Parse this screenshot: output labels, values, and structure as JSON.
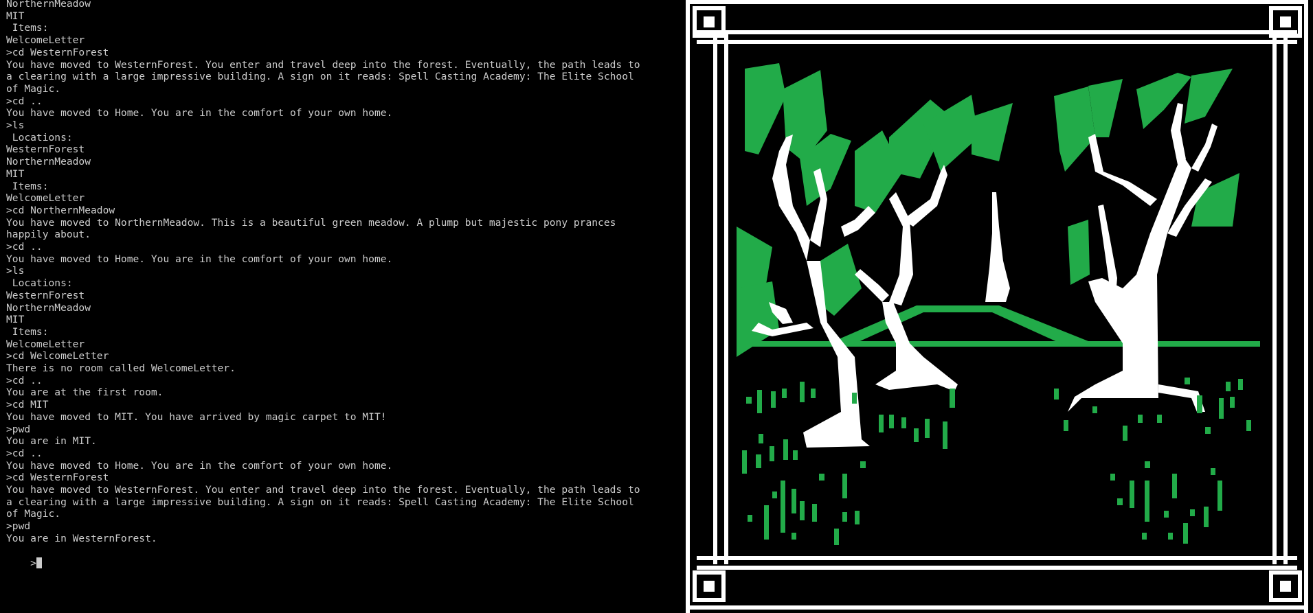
{
  "colors": {
    "background": "#000000",
    "text": "#cccccc",
    "tree_green": "#22ab49",
    "frame_white": "#ffffff"
  },
  "terminal": {
    "lines": [
      "NorthernMeadow",
      "MIT",
      " Items:",
      "WelcomeLetter",
      ">cd WesternForest",
      "You have moved to WesternForest. You enter and travel deep into the forest. Eventually, the path leads to",
      "a clearing with a large impressive building. A sign on it reads: Spell Casting Academy: The Elite School",
      "of Magic.",
      ">cd ..",
      "You have moved to Home. You are in the comfort of your own home.",
      ">ls",
      " Locations:",
      "WesternForest",
      "NorthernMeadow",
      "MIT",
      " Items:",
      "WelcomeLetter",
      ">cd NorthernMeadow",
      "You have moved to NorthernMeadow. This is a beautiful green meadow. A plump but majestic pony prances",
      "happily about.",
      ">cd ..",
      "You have moved to Home. You are in the comfort of your own home.",
      ">ls",
      " Locations:",
      "WesternForest",
      "NorthernMeadow",
      "MIT",
      " Items:",
      "WelcomeLetter",
      ">cd WelcomeLetter",
      "There is no room called WelcomeLetter.",
      ">cd ..",
      "You are at the first room.",
      ">cd MIT",
      "You have moved to MIT. You have arrived by magic carpet to MIT!",
      ">pwd",
      "You are in MIT.",
      ">cd ..",
      "You have moved to Home. You are in the comfort of your own home.",
      ">cd WesternForest",
      "You have moved to WesternForest. You enter and travel deep into the forest. Eventually, the path leads to",
      "a clearing with a large impressive building. A sign on it reads: Spell Casting Academy: The Elite School",
      "of Magic.",
      ">pwd",
      "You are in WesternForest."
    ],
    "prompt": ">"
  }
}
